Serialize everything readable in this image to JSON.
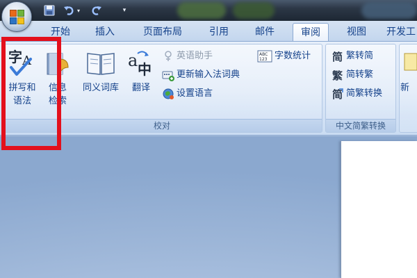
{
  "tabs": [
    {
      "label": "开始",
      "active": false
    },
    {
      "label": "插入",
      "active": false
    },
    {
      "label": "页面布局",
      "active": false
    },
    {
      "label": "引用",
      "active": false
    },
    {
      "label": "邮件",
      "active": false
    },
    {
      "label": "审阅",
      "active": true
    },
    {
      "label": "视图",
      "active": false
    },
    {
      "label": "开发工",
      "active": false
    }
  ],
  "quick_access": {
    "icons": [
      "save-icon",
      "undo-icon",
      "redo-icon",
      "customize-icon"
    ]
  },
  "proofing_group": {
    "label": "校对",
    "spelling_line1": "拼写和",
    "spelling_line2": "语法",
    "research_line1": "信息",
    "research_line2": "检索",
    "thesaurus": "同义词库",
    "translate": "翻译",
    "english_assistant": "英语助手",
    "update_ime_dictionary": "更新输入法词典",
    "set_language": "设置语言",
    "word_count": "字数统计"
  },
  "chinese_conversion_group": {
    "label": "中文简繁转换",
    "trad_to_simp": "繁转简",
    "simp_to_trad": "简转繁",
    "convert": "简繁转换"
  },
  "partial_group": {
    "label_fragment": "新"
  },
  "icons": {
    "spelling": "spelling-grammar-icon",
    "research": "research-book-icon",
    "thesaurus": "thesaurus-book-icon",
    "translate": "translate-icon",
    "english_assistant": "english-assistant-icon",
    "update_dictionary": "update-dictionary-icon",
    "set_language": "set-language-icon",
    "word_count": "word-count-icon",
    "trad_to_simp": "trad-to-simp-icon",
    "simp_to_trad": "simp-to-trad-icon",
    "convert": "convert-icon"
  },
  "colors": {
    "accent_text": "#15428b",
    "highlight": "#e3101c",
    "ribbon_bg": "#dbe7f7",
    "titlebar_bg": "#2c3746"
  }
}
